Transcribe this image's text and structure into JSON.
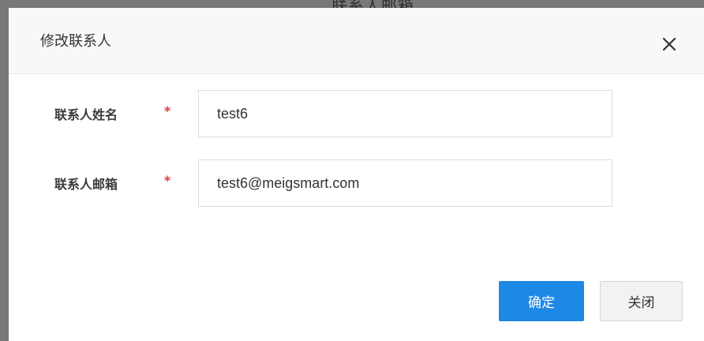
{
  "backdrop": {
    "text": "联系人邮箱"
  },
  "dialog": {
    "title": "修改联系人",
    "close_icon": "close-icon",
    "fields": [
      {
        "label": "联系人姓名",
        "required_mark": "*",
        "value": "test6"
      },
      {
        "label": "联系人邮箱",
        "required_mark": "*",
        "value": "test6@meigsmart.com"
      }
    ],
    "buttons": {
      "confirm_label": "确定",
      "close_label": "关闭"
    }
  },
  "colors": {
    "primary": "#1e88e5",
    "required": "#e4393c",
    "overlay": "#787878"
  }
}
